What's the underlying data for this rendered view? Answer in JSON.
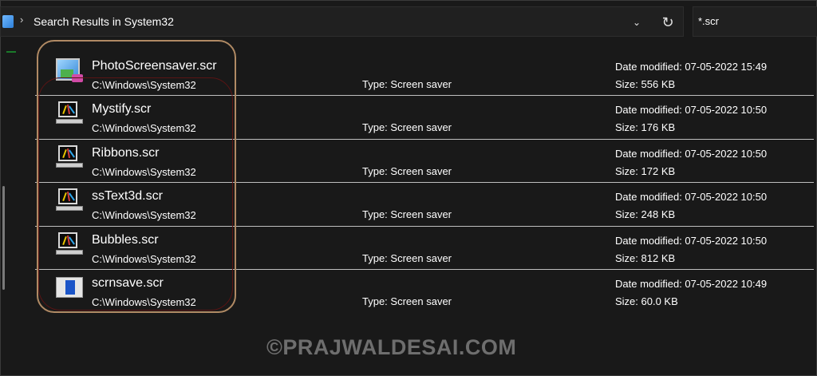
{
  "address_bar": {
    "breadcrumb": "Search Results in System32",
    "chevron_glyph": "›",
    "dropdown_glyph": "⌄",
    "refresh_glyph": "↻"
  },
  "search": {
    "value": "*.scr"
  },
  "results": [
    {
      "name": "PhotoScreensaver.scr",
      "path": "C:\\Windows\\System32",
      "type": "Type: Screen saver",
      "date": "Date modified: 07-05-2022 15:49",
      "size": "Size: 556 KB",
      "icon": "photo-screensaver-icon"
    },
    {
      "name": "Mystify.scr",
      "path": "C:\\Windows\\System32",
      "type": "Type: Screen saver",
      "date": "Date modified: 07-05-2022 10:50",
      "size": "Size: 176 KB",
      "icon": "screensaver-monitor-icon"
    },
    {
      "name": "Ribbons.scr",
      "path": "C:\\Windows\\System32",
      "type": "Type: Screen saver",
      "date": "Date modified: 07-05-2022 10:50",
      "size": "Size: 172 KB",
      "icon": "screensaver-monitor-icon"
    },
    {
      "name": "ssText3d.scr",
      "path": "C:\\Windows\\System32",
      "type": "Type: Screen saver",
      "date": "Date modified: 07-05-2022 10:50",
      "size": "Size: 248 KB",
      "icon": "screensaver-monitor-icon"
    },
    {
      "name": "Bubbles.scr",
      "path": "C:\\Windows\\System32",
      "type": "Type: Screen saver",
      "date": "Date modified: 07-05-2022 10:50",
      "size": "Size: 812 KB",
      "icon": "screensaver-monitor-icon"
    },
    {
      "name": "scrnsave.scr",
      "path": "C:\\Windows\\System32",
      "type": "Type: Screen saver",
      "date": "Date modified: 07-05-2022 10:49",
      "size": "Size: 60.0 KB",
      "icon": "scrnsave-icon"
    }
  ],
  "watermark": "©PRAJWALDESAI.COM",
  "colors": {
    "background": "#191919",
    "highlight_outline": "#b08a64",
    "separator": "#bfbfbf"
  }
}
